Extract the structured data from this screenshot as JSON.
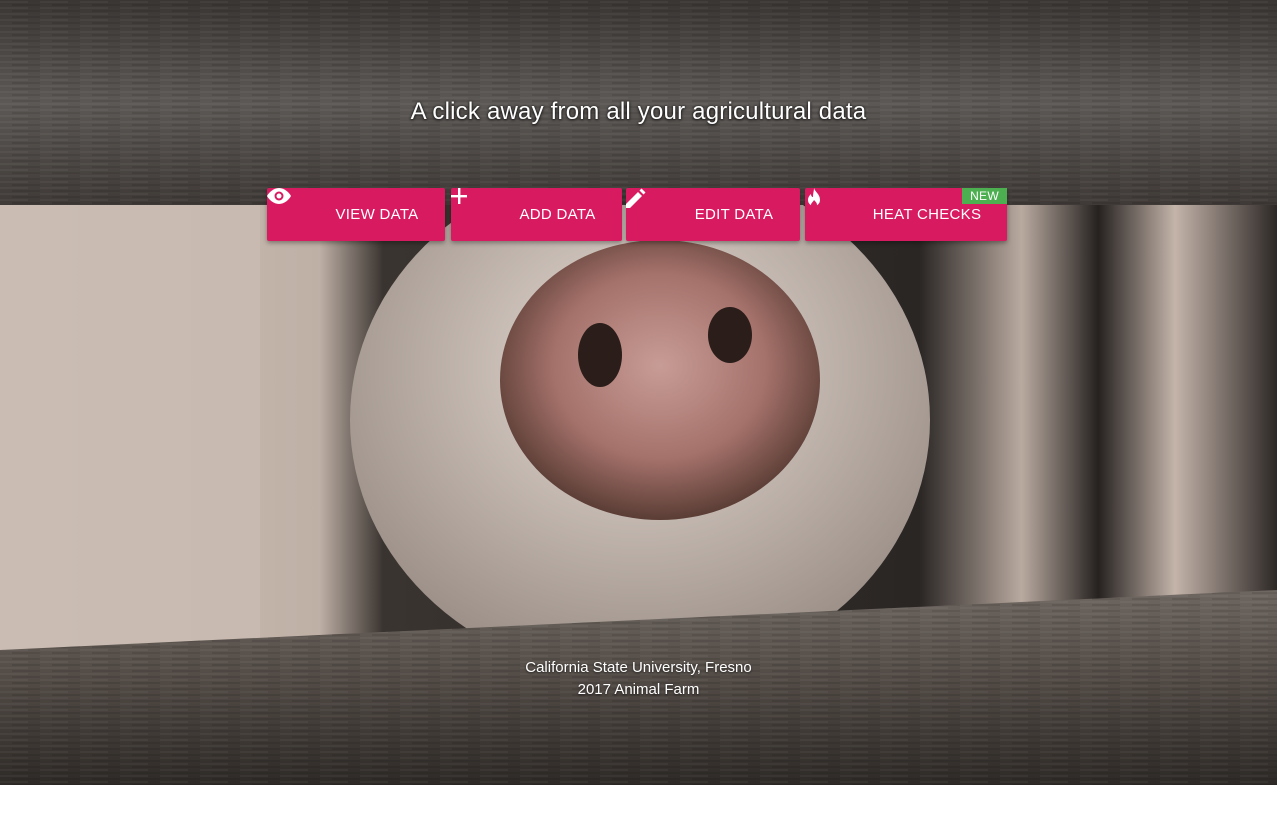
{
  "hero": {
    "tagline": "A click away from all your agricultural data",
    "image_subject": "pig-snout-through-fence-photo"
  },
  "actions": [
    {
      "label": "VIEW DATA",
      "icon": "eye-icon"
    },
    {
      "label": "ADD DATA",
      "icon": "plus-icon"
    },
    {
      "label": "EDIT DATA",
      "icon": "pencil-icon"
    },
    {
      "label": "HEAT CHECKS",
      "icon": "fire-icon",
      "badge": "NEW"
    }
  ],
  "footer": {
    "line1": "California State University, Fresno",
    "line2": "2017 Animal Farm"
  },
  "colors": {
    "button": "#d81b60",
    "badge": "#4caf50",
    "text": "#ffffff"
  }
}
